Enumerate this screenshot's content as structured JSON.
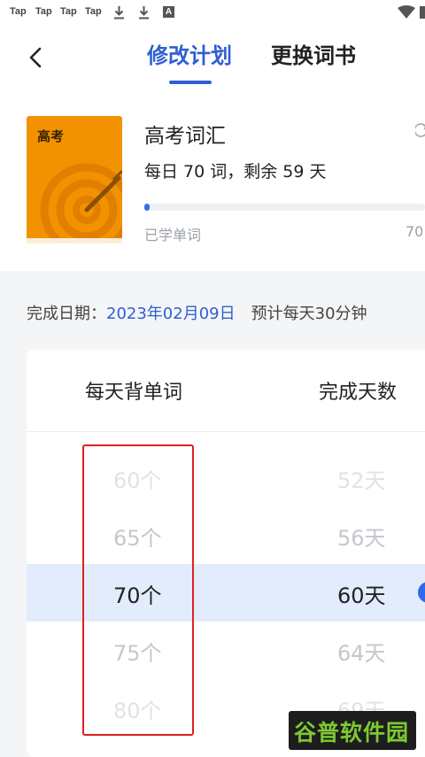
{
  "status_bar": {
    "tap_labels": [
      "Tap",
      "Tap",
      "Tap",
      "Tap"
    ],
    "notification_icons": [
      "download-icon",
      "download-icon",
      "a-icon"
    ],
    "right_icons": [
      "wifi-icon",
      "battery-icon"
    ]
  },
  "header": {
    "back_icon": "chevron-left-icon",
    "tabs": [
      {
        "label": "修改计划",
        "active": true
      },
      {
        "label": "更换词书",
        "active": false
      }
    ],
    "active_color": "#2f5fd0"
  },
  "book": {
    "cover_label": "高考",
    "cover_color": "#f39200",
    "title": "高考词汇",
    "subtitle": "每日 70 词，剩余 59 天",
    "progress_fraction": 0.02,
    "learned_label": "已学单词",
    "learned_count": "70"
  },
  "completion": {
    "label": "完成日期：",
    "date": "2023年02月09日",
    "estimate": "预计每天30分钟"
  },
  "picker": {
    "col1_header": "每天背单词",
    "col2_header": "完成天数",
    "rows": [
      {
        "words": "60个",
        "days": "52天"
      },
      {
        "words": "65个",
        "days": "56天"
      },
      {
        "words": "70个",
        "days": "60天",
        "selected": true
      },
      {
        "words": "75个",
        "days": "64天"
      },
      {
        "words": "80个",
        "days": "69天"
      }
    ],
    "highlight_color": "#e3ecfc"
  },
  "watermark": {
    "text": "谷普软件园"
  }
}
